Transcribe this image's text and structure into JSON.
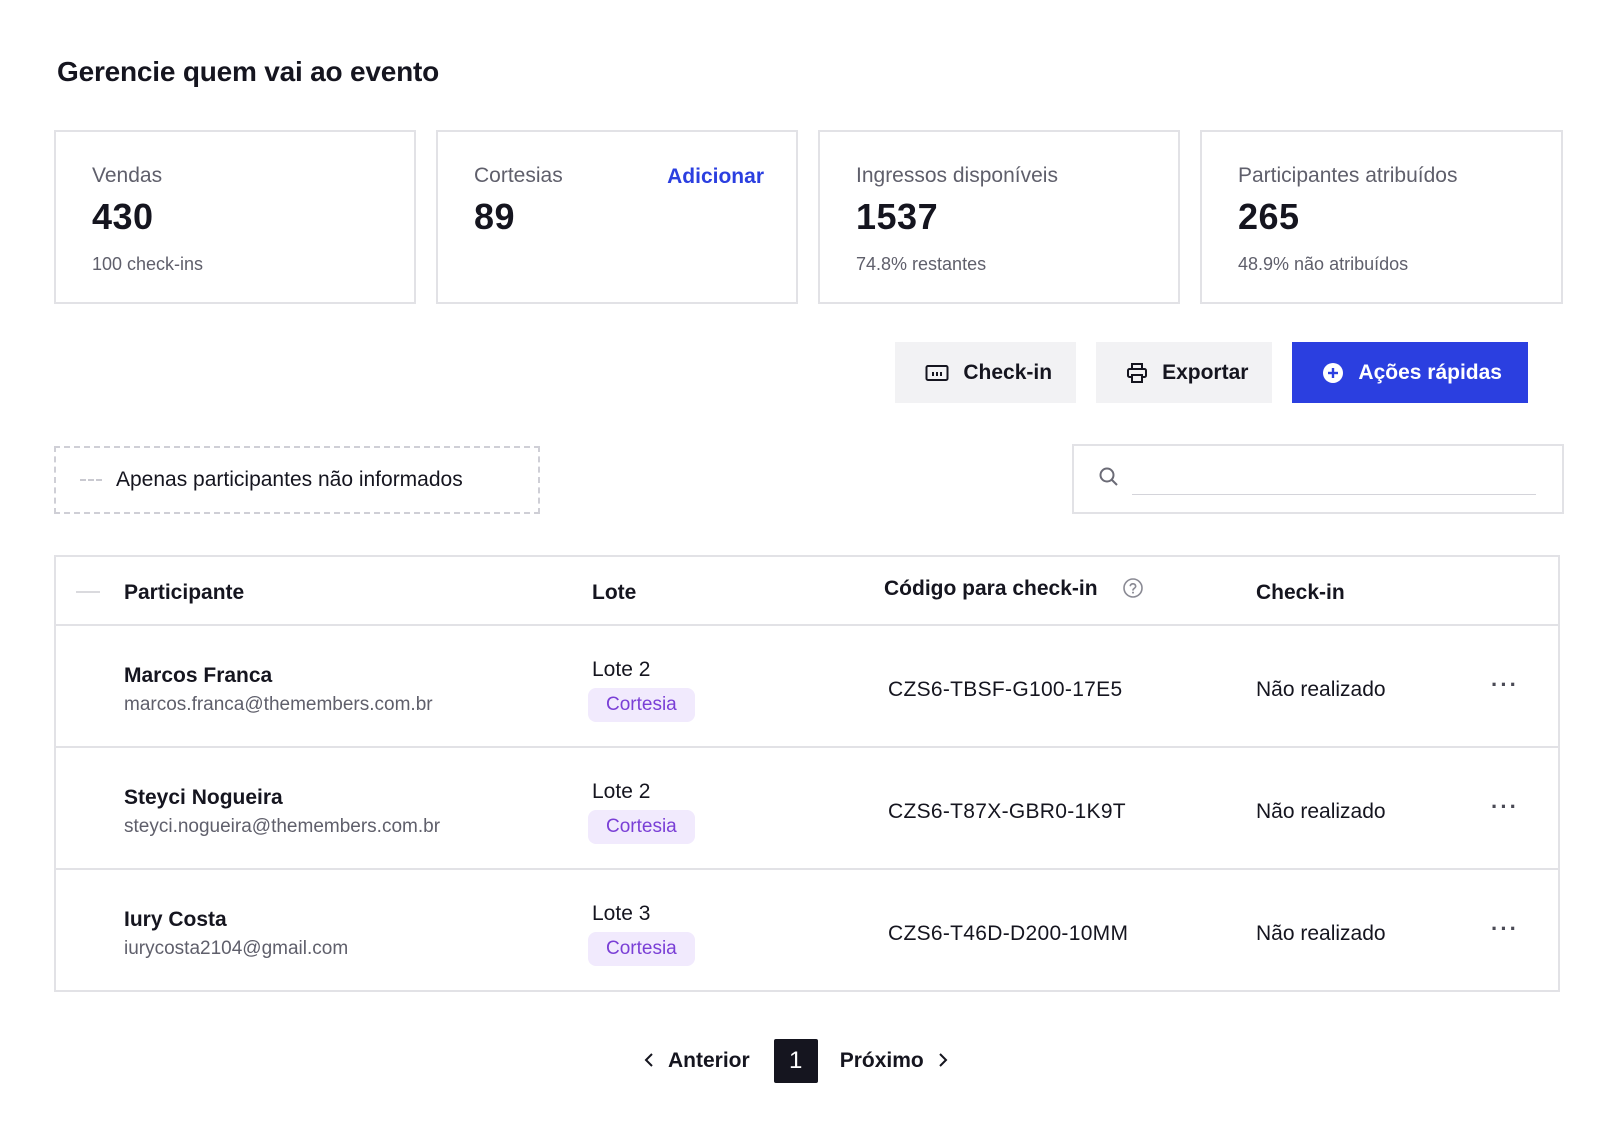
{
  "page": {
    "title": "Gerencie quem vai ao evento"
  },
  "stats": [
    {
      "label": "Vendas",
      "value": "430",
      "sub": "100 check-ins"
    },
    {
      "label": "Cortesias",
      "value": "89",
      "action": "Adicionar"
    },
    {
      "label": "Ingressos disponíveis",
      "value": "1537",
      "sub": "74.8% restantes"
    },
    {
      "label": "Participantes atribuídos",
      "value": "265",
      "sub": "48.9% não atribuídos"
    }
  ],
  "toolbar": {
    "checkin_label": "Check-in",
    "export_label": "Exportar",
    "quick_actions_label": "Ações rápidas"
  },
  "filter": {
    "label": "Apenas participantes não informados"
  },
  "search": {
    "placeholder": "",
    "value": ""
  },
  "table": {
    "columns": [
      "Participante",
      "Lote",
      "Código para check-in",
      "Check-in"
    ],
    "rows": [
      {
        "name": "Marcos Franca",
        "email": "marcos.franca@themembers.com.br",
        "lote": "Lote 2",
        "badge": "Cortesia",
        "code": "CZS6-TBSF-G100-17E5",
        "checkin": "Não realizado"
      },
      {
        "name": "Steyci Nogueira",
        "email": "steyci.nogueira@themembers.com.br",
        "lote": "Lote 2",
        "badge": "Cortesia",
        "code": "CZS6-T87X-GBR0-1K9T",
        "checkin": "Não realizado"
      },
      {
        "name": "Iury Costa",
        "email": "iurycosta2104@gmail.com",
        "lote": "Lote 3",
        "badge": "Cortesia",
        "code": "CZS6-T46D-D200-10MM",
        "checkin": "Não realizado"
      }
    ]
  },
  "pagination": {
    "prev_label": "Anterior",
    "current": "1",
    "next_label": "Próximo"
  },
  "colors": {
    "primary": "#2b3fe0",
    "badge_bg": "#f1eafd",
    "badge_text": "#7a3fd6",
    "border": "#e2e2e6"
  },
  "icons": {
    "checkin": "ticket-icon",
    "export": "printer-icon",
    "quick_actions": "plus-circle-icon",
    "search": "search-icon",
    "help": "help-circle-icon",
    "more": "more-horizontal-icon",
    "prev": "chevron-left-icon",
    "next": "chevron-right-icon"
  }
}
